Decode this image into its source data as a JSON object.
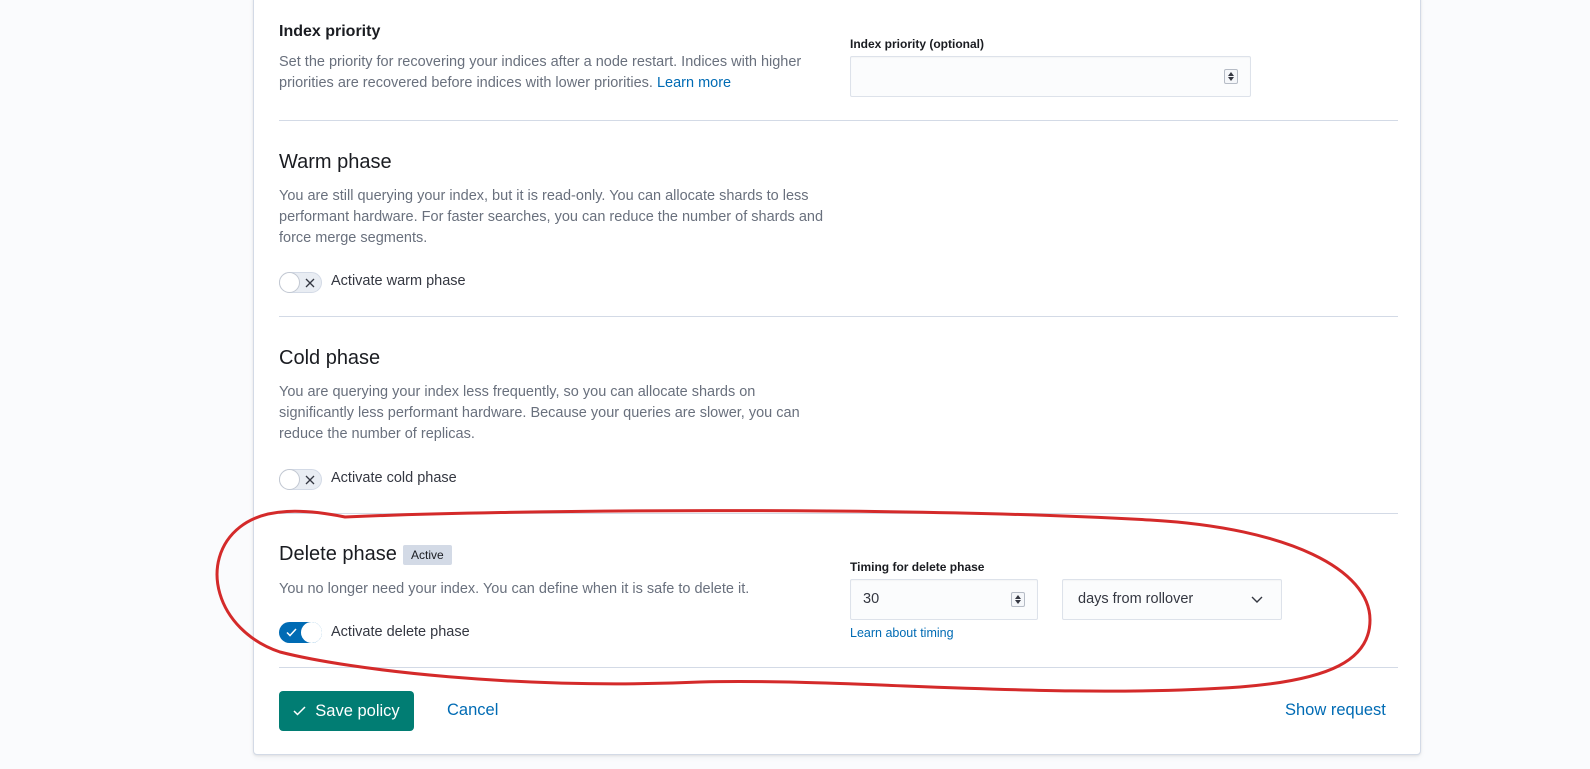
{
  "index_priority": {
    "title": "Index priority",
    "description": "Set the priority for recovering your indices after a node restart. Indices with higher priorities are recovered before indices with lower priorities.",
    "learn_more": "Learn more",
    "field_label": "Index priority (optional)",
    "value": ""
  },
  "warm_phase": {
    "title": "Warm phase",
    "description": "You are still querying your index, but it is read-only. You can allocate shards to less performant hardware. For faster searches, you can reduce the number of shards and force merge segments.",
    "toggle_label": "Activate warm phase",
    "enabled": false
  },
  "cold_phase": {
    "title": "Cold phase",
    "description": "You are querying your index less frequently, so you can allocate shards on significantly less performant hardware. Because your queries are slower, you can reduce the number of replicas.",
    "toggle_label": "Activate cold phase",
    "enabled": false
  },
  "delete_phase": {
    "title": "Delete phase",
    "badge": "Active",
    "description": "You no longer need your index. You can define when it is safe to delete it.",
    "toggle_label": "Activate delete phase",
    "enabled": true,
    "timing_label": "Timing for delete phase",
    "timing_value": "30",
    "timing_unit": "days from rollover",
    "timing_link": "Learn about timing"
  },
  "footer": {
    "save_label": "Save policy",
    "cancel_label": "Cancel",
    "show_request_label": "Show request"
  },
  "colors": {
    "primary": "#017d73",
    "link": "#006bb4",
    "annotation": "#d42a2a"
  },
  "icons": {
    "save": "check-icon",
    "switch_off": "cross-icon",
    "switch_on": "check-icon",
    "select": "chevron-down-icon",
    "spinner": "number-spinner-icon"
  }
}
